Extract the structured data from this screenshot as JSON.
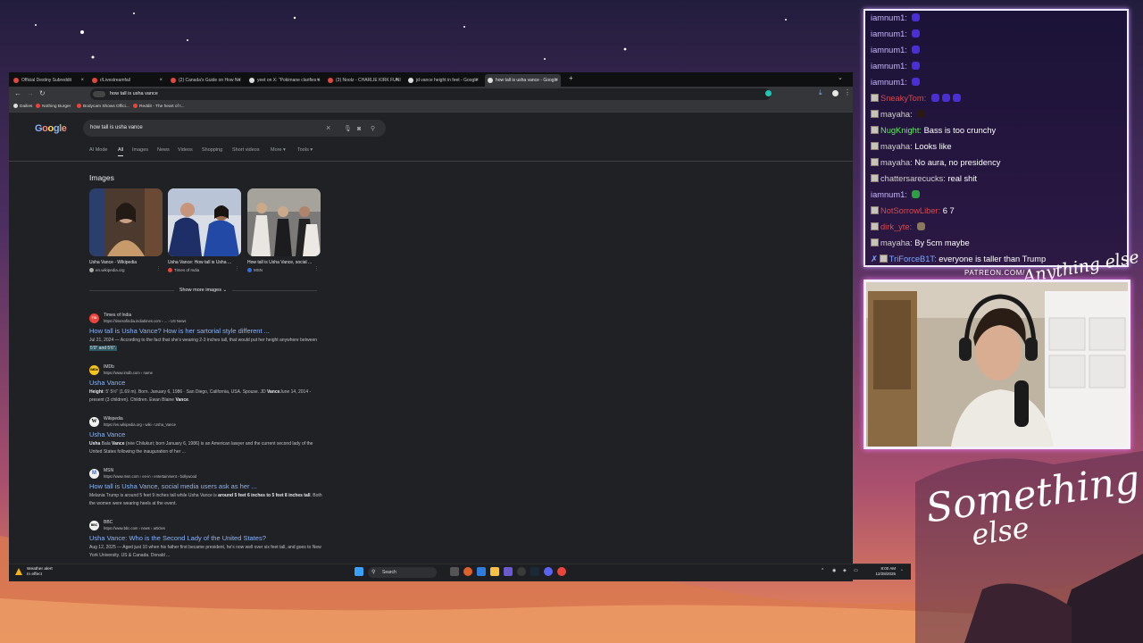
{
  "browser": {
    "tabs": [
      {
        "label": "Official Destiny Subreddit"
      },
      {
        "label": "r/Livestreamfail"
      },
      {
        "label": "(2) Canada's Guide on How No"
      },
      {
        "label": "yeet on X: \"Pokimane clarifies n"
      },
      {
        "label": "(3) Nootz - CHARLIE KIRK FUNI"
      },
      {
        "label": "jd vance height in feet - Google"
      },
      {
        "label": "how tall is usha vance - Google"
      }
    ],
    "new_tab": "+",
    "tab_menu": "⌄",
    "close": "×",
    "url": "how tall is usha vance",
    "bookmarks": [
      "Dailies",
      "Nothing Burger",
      "Bodycam Shows Offici...",
      "Reddit - The heart of t..."
    ]
  },
  "google": {
    "logo": "Google",
    "query": "how tall is usha vance",
    "filters": [
      "AI Mode",
      "All",
      "Images",
      "News",
      "Videos",
      "Shopping",
      "Short videos",
      "More ▾",
      "Tools ▾"
    ],
    "images_heading": "Images",
    "images": [
      {
        "title": "Usha Vance - Wikipedia",
        "source": "en.wikipedia.org"
      },
      {
        "title": "Usha Vance: How tall is Usha ...",
        "source": "Times of India"
      },
      {
        "title": "How tall is Usha Vance, social ...",
        "source": "MSN"
      }
    ],
    "show_more": "Show more images",
    "results": [
      {
        "site": "Times of India",
        "url": "https://timesofindia.indiatimes.com › ... › US News",
        "favicon": "TOI",
        "title": "How tall is Usha Vance? How is her sartorial style different ...",
        "snippet_pre": "Jul 21, 2024 — According to the fact that she's wearing 2-3 inches tall, that would put her height anywhere between",
        "snippet_hl": "5'0\" and 5'6\"."
      },
      {
        "site": "IMDb",
        "url": "https://www.imdb.com › name",
        "favicon": "IMDb",
        "title": "Usha Vance",
        "snippet_b1": "Height",
        "snippet_t1": ": 5' 5½\" (1.69 m). Born. January 6, 1986 · San Diego, California, USA. Spouse. JD ",
        "snippet_b2": "Vance",
        "snippet_t2": "June 14, 2014 - present (3 children). Children. Ewan Blaine ",
        "snippet_b3": "Vance",
        "snippet_t3": "."
      },
      {
        "site": "Wikipedia",
        "url": "https://en.wikipedia.org › wiki › Usha_Vance",
        "favicon": "W",
        "title": "Usha Vance",
        "snippet_b1": "Usha",
        "snippet_t1": " Bala ",
        "snippet_b2": "Vance",
        "snippet_t2": " (née Chilukuri; born January 6, 1986) is an American lawyer and the current second lady of the United States following the inauguration of her ..."
      },
      {
        "site": "MSN",
        "url": "https://www.msn.com › en-in › entertainment › bollywood",
        "favicon": "M",
        "title": "How tall is Usha Vance, social media users ask as her ...",
        "snippet_t1": "Melania Trump is around 5 feet 9 inches tall while Usha Vance is ",
        "snippet_b1": "around 5 feet 6 inches to 5 feet 8 inches tall",
        "snippet_t2": ". Both the women were wearing heels at the event."
      },
      {
        "site": "BBC",
        "url": "https://www.bbc.com › news › articles",
        "favicon": "BBC",
        "title": "Usha Vance: Who is the Second Lady of the United States?",
        "snippet_pre": "Aug 12, 2025 — Aged just 10 when his father first became president, he's now well over six feet tall, and goes to New York University. US & Canada. Donald ..."
      }
    ]
  },
  "taskbar": {
    "weather_title": "Weather alert",
    "weather_sub": "In effect",
    "search_label": "Search",
    "time": "8:00 AM",
    "date": "12/28/2025"
  },
  "chat": {
    "messages": [
      {
        "user": "iamnum1",
        "color": "#c6b8ff",
        "text": ""
      },
      {
        "user": "iamnum1",
        "color": "#c6b8ff",
        "text": ""
      },
      {
        "user": "iamnum1",
        "color": "#c6b8ff",
        "text": ""
      },
      {
        "user": "iamnum1",
        "color": "#c6b8ff",
        "text": ""
      },
      {
        "user": "iamnum1",
        "color": "#c6b8ff",
        "text": ""
      },
      {
        "user": "SneakyTom",
        "color": "#e0464a",
        "text": ""
      },
      {
        "user": "mayaha",
        "color": "#d2d2d2",
        "text": ""
      },
      {
        "user": "NugKnight",
        "color": "#5ef05a",
        "text": "Bass is too crunchy"
      },
      {
        "user": "mayaha",
        "color": "#d2d2d2",
        "text": "Looks like"
      },
      {
        "user": "mayaha",
        "color": "#d2d2d2",
        "text": "No aura, no presidency"
      },
      {
        "user": "chattersarecucks",
        "color": "#d2d2d2",
        "text": "real shit"
      },
      {
        "user": "iamnum1",
        "color": "#c6b8ff",
        "text": ""
      },
      {
        "user": "NotSorrowLiber",
        "color": "#e0464a",
        "text": "6 7"
      },
      {
        "user": "dirk_yte",
        "color": "#e0464a",
        "text": ""
      },
      {
        "user": "mayaha",
        "color": "#d2d2d2",
        "text": "By 5cm maybe"
      },
      {
        "user": "TriForceB1T",
        "color": "#7aa8ff",
        "text": "everyone is taller than Trump"
      }
    ]
  },
  "overlay": {
    "patreon": "PATREON.COM/",
    "anything": "Anything else",
    "something": "Something",
    "else": "else"
  }
}
